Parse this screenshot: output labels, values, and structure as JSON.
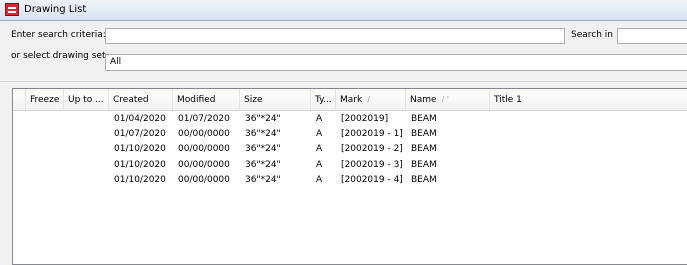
{
  "window": {
    "title": "Drawing List"
  },
  "search": {
    "label": "Enter search criteria:",
    "value": "",
    "search_in_label": "Search in",
    "search_in_value": ""
  },
  "drawing_set": {
    "label": "or select drawing set",
    "selected": "All"
  },
  "table": {
    "columns": [
      {
        "label": "Freeze",
        "sort_indicator": ""
      },
      {
        "label": "Up to ...",
        "sort_indicator": ""
      },
      {
        "label": "Created",
        "sort_indicator": ""
      },
      {
        "label": "Modified",
        "sort_indicator": ""
      },
      {
        "label": "Size",
        "sort_indicator": ""
      },
      {
        "label": "Ty...",
        "sort_indicator": ""
      },
      {
        "label": "Mark",
        "sort_indicator": "/"
      },
      {
        "label": "Name",
        "sort_indicator": "/ '"
      },
      {
        "label": "Title 1",
        "sort_indicator": ""
      }
    ],
    "rows": [
      {
        "created": "01/04/2020",
        "modified": "01/07/2020",
        "size": "36\"*24\"",
        "type": "A",
        "mark": "[2002019]",
        "name": "BEAM"
      },
      {
        "created": "01/07/2020",
        "modified": "00/00/0000",
        "size": "36\"*24\"",
        "type": "A",
        "mark": "[2002019 - 1]",
        "name": "BEAM"
      },
      {
        "created": "01/10/2020",
        "modified": "00/00/0000",
        "size": "36\"*24\"",
        "type": "A",
        "mark": "[2002019 - 2]",
        "name": "BEAM"
      },
      {
        "created": "01/10/2020",
        "modified": "00/00/0000",
        "size": "36\"*24\"",
        "type": "A",
        "mark": "[2002019 - 3]",
        "name": "BEAM"
      },
      {
        "created": "01/10/2020",
        "modified": "00/00/0000",
        "size": "36\"*24\"",
        "type": "A",
        "mark": "[2002019 - 4]",
        "name": "BEAM"
      }
    ]
  }
}
